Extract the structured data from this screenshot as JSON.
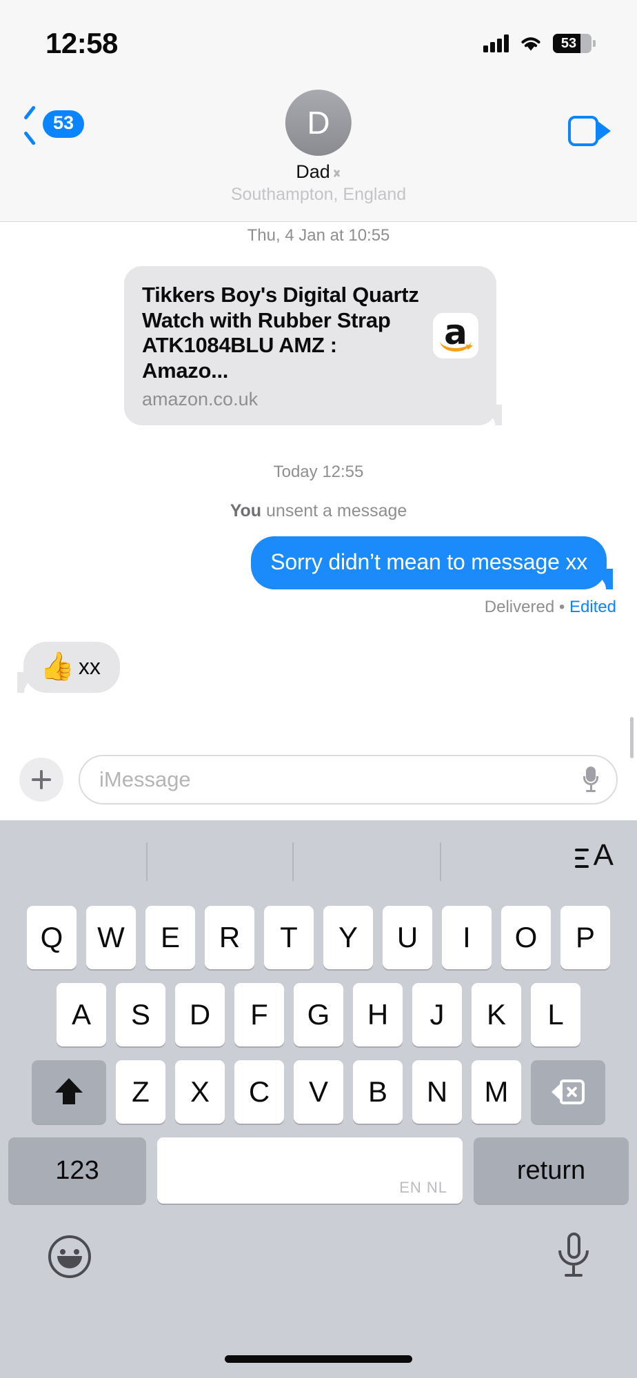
{
  "status_bar": {
    "time": "12:58",
    "signal_icon": "cellular-signal-icon",
    "wifi_icon": "wifi-icon",
    "battery_percent": "53",
    "battery_icon": "battery-icon"
  },
  "nav": {
    "back_icon": "chevron-left-icon",
    "back_badge": "53",
    "avatar_initial": "D",
    "contact_name": "Dad",
    "contact_chevron_icon": "chevron-right-icon",
    "contact_sublabel": "Southampton, England",
    "facetime_icon": "video-camera-icon"
  },
  "thread": {
    "timestamp_clipped": "Thu, 4 Jan at 10:55",
    "link_preview": {
      "title": "Tikkers Boy's Digital Quartz Watch with Rubber Strap ATK1084BLU AMZ : Amazo...",
      "domain": "amazon.co.uk",
      "favicon_icon": "amazon-logo-icon",
      "favicon_letter": "a"
    },
    "today_timestamp": "Today 12:55",
    "unsent_you": "You",
    "unsent_rest": " unsent a message",
    "sent_message": "Sorry didn’t mean to message xx",
    "delivered_label": "Delivered",
    "delivered_separator": "•",
    "edited_label": "Edited",
    "reply_emoji": "👍",
    "reply_text": "xx"
  },
  "input_bar": {
    "plus_icon": "plus-icon",
    "placeholder": "iMessage",
    "mic_icon": "microphone-icon"
  },
  "keyboard": {
    "format_icon": "text-formatting-icon",
    "format_letter": "A",
    "row1": [
      "Q",
      "W",
      "E",
      "R",
      "T",
      "Y",
      "U",
      "I",
      "O",
      "P"
    ],
    "row2": [
      "A",
      "S",
      "D",
      "F",
      "G",
      "H",
      "J",
      "K",
      "L"
    ],
    "row3": [
      "Z",
      "X",
      "C",
      "V",
      "B",
      "N",
      "M"
    ],
    "shift_icon": "shift-arrow-icon",
    "backspace_icon": "backspace-icon",
    "numbers_key": "123",
    "space_lang": "EN NL",
    "return_key": "return",
    "emoji_icon": "emoji-smiley-icon",
    "dictation_icon": "microphone-icon"
  },
  "colors": {
    "accent_blue": "#0a84ff",
    "sent_bubble": "#1b8bfb",
    "recv_bubble": "#e6e6e8",
    "keyboard_bg": "#ccced5"
  }
}
